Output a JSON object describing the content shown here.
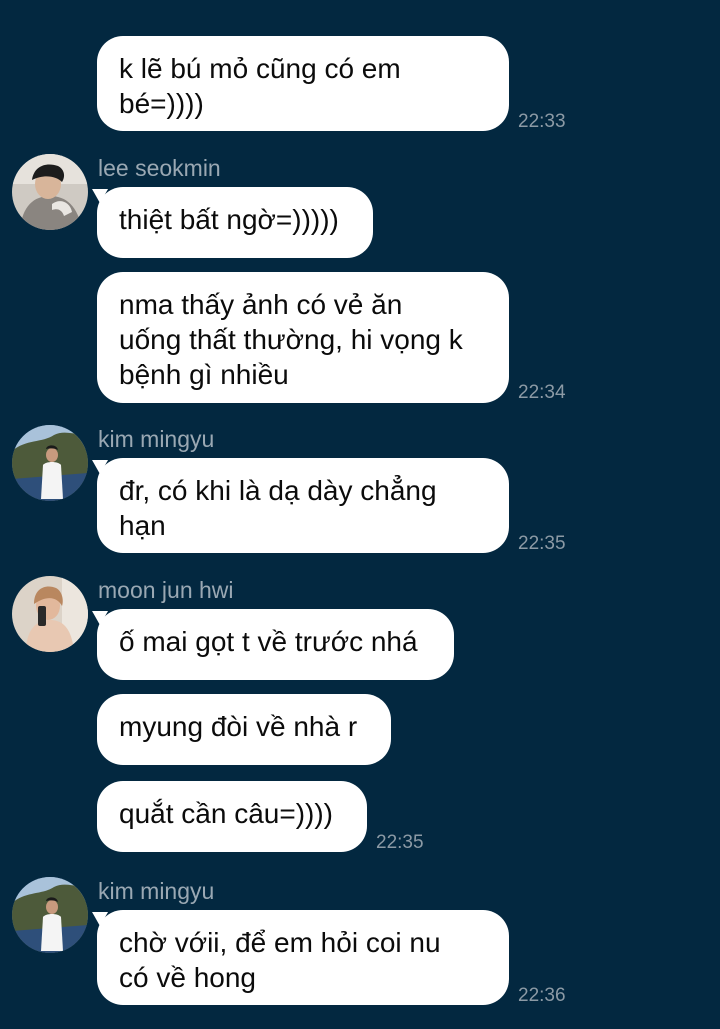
{
  "messages": [
    {
      "lines": [
        "k lẽ bú mỏ cũng có em",
        "bé=))))"
      ],
      "time": "22:33"
    },
    {
      "sender": "lee seokmin",
      "lines": [
        "thiệt bất ngờ=)))))"
      ]
    },
    {
      "lines": [
        "nma thấy ảnh có vẻ ăn",
        "uống thất thường, hi vọng k",
        "bệnh gì nhiều"
      ],
      "time": "22:34"
    },
    {
      "sender": "kim mingyu",
      "lines": [
        "đr, có khi là dạ dày chẳng",
        "hạn"
      ],
      "time": "22:35"
    },
    {
      "sender": "moon jun hwi",
      "lines": [
        "ố mai gọt t về trước nhá"
      ]
    },
    {
      "lines": [
        "myung đòi về nhà r"
      ]
    },
    {
      "lines": [
        "quắt cần câu=))))"
      ],
      "time": "22:35"
    },
    {
      "sender": "kim mingyu",
      "lines": [
        "chờ vớii, để em hỏi coi nu",
        "có về hong"
      ],
      "time": "22:36"
    }
  ],
  "avatars": {
    "lee_seokmin": "lee-seokmin-avatar",
    "kim_mingyu": "kim-mingyu-avatar",
    "moon_jun_hwi": "moon-jun-hwi-avatar"
  },
  "colors": {
    "background": "#032840",
    "bubble": "#ffffff",
    "text": "#0b0b0b",
    "sender": "#9aa8b3",
    "timestamp": "#8c9aa5"
  }
}
